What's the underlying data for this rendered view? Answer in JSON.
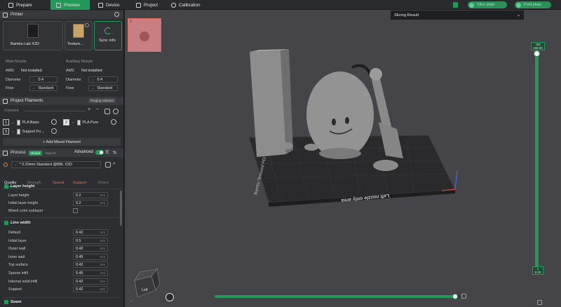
{
  "topbar": {
    "tabs": [
      {
        "label": "Prepare",
        "icon": "prepare-icon"
      },
      {
        "label": "Preview",
        "icon": "preview-icon",
        "active": true
      },
      {
        "label": "Device",
        "icon": "device-icon"
      },
      {
        "label": "Project",
        "icon": "project-icon"
      },
      {
        "label": "Calibration",
        "icon": "calibration-icon"
      }
    ],
    "slice_plate": "Slice plate",
    "print_plate": "Print plate"
  },
  "printer": {
    "section_title": "Printer",
    "printer_name": "Bambu Lab X2D",
    "plate_label": "Texture...",
    "sync_label": "Sync info",
    "main_nozzle": {
      "title": "Main Nozzle",
      "ams_label": "AMS",
      "ams_value": "Not installed",
      "diameter_label": "Diameter",
      "diameter_value": "0.4",
      "flow_label": "Flow",
      "flow_value": "Standard"
    },
    "aux_nozzle": {
      "title": "Auxiliary Nozzle",
      "ams_label": "AMS",
      "ams_value": "Not installed",
      "diameter_label": "Diameter",
      "diameter_value": "0.4",
      "flow_label": "Flow",
      "flow_value": "Standard"
    }
  },
  "filaments": {
    "section_title": "Project Filaments",
    "badge": "Purging volumes",
    "filament_label": "Filament",
    "items": [
      {
        "num": "1",
        "name": "PLA Basic"
      },
      {
        "num": "2",
        "name": "PLA Pure"
      },
      {
        "num": "3",
        "name": "Support Fo..."
      }
    ],
    "add_mixed": "+ Add Mixed Filament"
  },
  "process": {
    "section_title": "Process",
    "global_label": "Global",
    "objects_label": "Objects",
    "advanced_label": "Advanced",
    "preset": "* 0.20mm Standard @BBL X2D",
    "tabs": [
      "Quality",
      "Strength",
      "Speed",
      "Support",
      "Others"
    ],
    "layer_height_group": "Layer height",
    "layer_height_label": "Layer height",
    "layer_height_value": "0.2",
    "layer_height_unit": "mm",
    "initial_layer_height_label": "Initial layer height",
    "initial_layer_height_value": "0.2",
    "initial_layer_height_unit": "mm",
    "mixed_color_label": "Mixed color sublayer",
    "line_width_group": "Line width",
    "line_widths": [
      {
        "label": "Default",
        "value": "0.42",
        "unit": "mm"
      },
      {
        "label": "Initial layer",
        "value": "0.5",
        "unit": "mm"
      },
      {
        "label": "Outer wall",
        "value": "0.42",
        "unit": "mm"
      },
      {
        "label": "Inner wall",
        "value": "0.45",
        "unit": "mm"
      },
      {
        "label": "Top surface",
        "value": "0.42",
        "unit": "mm"
      },
      {
        "label": "Sparse infill",
        "value": "0.45",
        "unit": "mm"
      },
      {
        "label": "Internal solid infill",
        "value": "0.42",
        "unit": "mm"
      },
      {
        "label": "Support",
        "value": "0.42",
        "unit": "mm"
      }
    ],
    "seam_group": "Seam"
  },
  "viewport": {
    "slicing_result": "Slicing Result",
    "plate_number": "1",
    "bed_text": "Left nozzle only area",
    "bed_brand": "Bambu Textured PEI",
    "layer_top_value": "750",
    "layer_top_height": "150.00",
    "layer_bottom_value": "1",
    "layer_bottom_height": "0.20",
    "cube_label": "Left",
    "horizontal_progress": 0.98,
    "colors": {
      "accent": "#1f9b57",
      "bed": "#2a2a2c",
      "model": "#8c8c8c"
    }
  }
}
